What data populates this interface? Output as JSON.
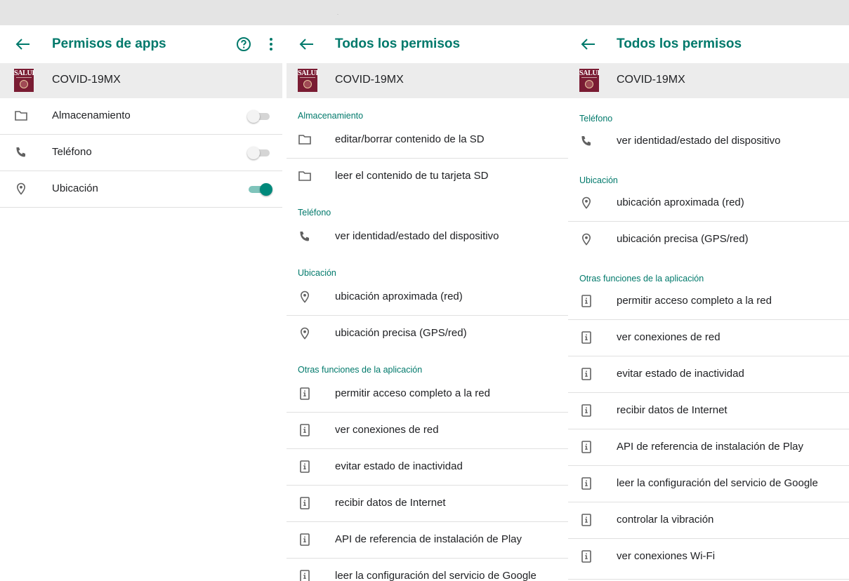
{
  "colors": {
    "accent": "#00796b",
    "toggle_on": "#00897b",
    "app_logo": "#7a1c33"
  },
  "app": {
    "name": "COVID-19MX",
    "logo_text": "SALUD"
  },
  "panel1": {
    "title": "Permisos de apps",
    "toggles": [
      {
        "label": "Almacenamiento",
        "icon": "folder-icon",
        "enabled": false
      },
      {
        "label": "Teléfono",
        "icon": "phone-icon",
        "enabled": false
      },
      {
        "label": "Ubicación",
        "icon": "location-icon",
        "enabled": true
      }
    ]
  },
  "panel2": {
    "title": "Todos los permisos",
    "sections": [
      {
        "header": "Almacenamiento",
        "items": [
          {
            "label": "editar/borrar contenido de la SD",
            "icon": "folder-icon"
          },
          {
            "label": "leer el contenido de tu tarjeta SD",
            "icon": "folder-icon"
          }
        ]
      },
      {
        "header": "Teléfono",
        "items": [
          {
            "label": "ver identidad/estado del dispositivo",
            "icon": "phone-icon"
          }
        ]
      },
      {
        "header": "Ubicación",
        "items": [
          {
            "label": "ubicación aproximada (red)",
            "icon": "location-icon"
          },
          {
            "label": "ubicación precisa (GPS/red)",
            "icon": "location-icon"
          }
        ]
      },
      {
        "header": "Otras funciones de la aplicación",
        "items": [
          {
            "label": "permitir acceso completo a la red",
            "icon": "info-device-icon"
          },
          {
            "label": "ver conexiones de red",
            "icon": "info-device-icon"
          },
          {
            "label": "evitar estado de inactividad",
            "icon": "info-device-icon"
          },
          {
            "label": "recibir datos de Internet",
            "icon": "info-device-icon"
          },
          {
            "label": "API de referencia de instalación de Play",
            "icon": "info-device-icon"
          },
          {
            "label": "leer la configuración del servicio de Google",
            "icon": "info-device-icon"
          }
        ]
      }
    ]
  },
  "panel3": {
    "title": "Todos los permisos",
    "sections": [
      {
        "header": "Teléfono",
        "items": [
          {
            "label": "ver identidad/estado del dispositivo",
            "icon": "phone-icon"
          }
        ]
      },
      {
        "header": "Ubicación",
        "items": [
          {
            "label": "ubicación aproximada (red)",
            "icon": "location-icon"
          },
          {
            "label": "ubicación precisa (GPS/red)",
            "icon": "location-icon"
          }
        ]
      },
      {
        "header": "Otras funciones de la aplicación",
        "items": [
          {
            "label": "permitir acceso completo a la red",
            "icon": "info-device-icon"
          },
          {
            "label": "ver conexiones de red",
            "icon": "info-device-icon"
          },
          {
            "label": "evitar estado de inactividad",
            "icon": "info-device-icon"
          },
          {
            "label": "recibir datos de Internet",
            "icon": "info-device-icon"
          },
          {
            "label": "API de referencia de instalación de Play",
            "icon": "info-device-icon"
          },
          {
            "label": "leer la configuración del servicio de Google",
            "icon": "info-device-icon"
          },
          {
            "label": "controlar la vibración",
            "icon": "info-device-icon"
          },
          {
            "label": "ver conexiones Wi-Fi",
            "icon": "info-device-icon"
          }
        ]
      }
    ]
  }
}
